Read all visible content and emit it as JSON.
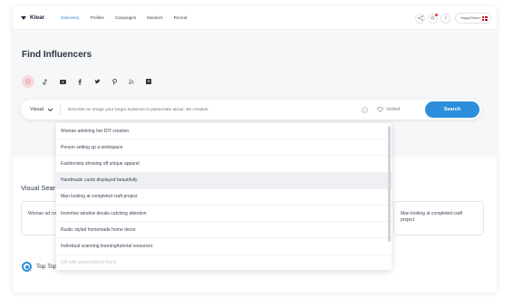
{
  "brand": {
    "name": "Klear"
  },
  "nav": {
    "items": [
      "Discovery",
      "Profiles",
      "Campaigns",
      "Monitors",
      "Recruit"
    ],
    "active": "Discovery"
  },
  "user": {
    "name": "Happy Brand"
  },
  "page": {
    "title": "Find Influencers"
  },
  "platforms": [
    "instagram",
    "tiktok",
    "youtube",
    "facebook",
    "twitter",
    "pinterest",
    "blogs",
    "twitch"
  ],
  "search": {
    "mode": "Visual",
    "placeholder": "Describe an image your target audience is passionate about. Be creative.",
    "vetted_label": "Vetted",
    "button_label": "Search"
  },
  "dropdown": {
    "items": [
      "Woman admiring her DIY creation",
      "Person setting up a workspace",
      "Fashionista showing off unique apparel",
      "Handmade cards displayed beautifully",
      "Man looking at completed craft project",
      "Inventive window decals catching attention",
      "Rustic styled homemade home decor",
      "Individual scanning learning/tutorial resources",
      "Gift with personalized touch"
    ],
    "highlighted_index": 3
  },
  "visual_search": {
    "title": "Visual Sear",
    "card_left": "Woman ad creation",
    "card_right": "Man looking at completed craft project"
  },
  "top_topics": {
    "label": "Top Topics"
  },
  "colors": {
    "accent": "#2d8fdb",
    "active_nav": "#2a84d8",
    "instagram_bg": "#f8d9de"
  }
}
